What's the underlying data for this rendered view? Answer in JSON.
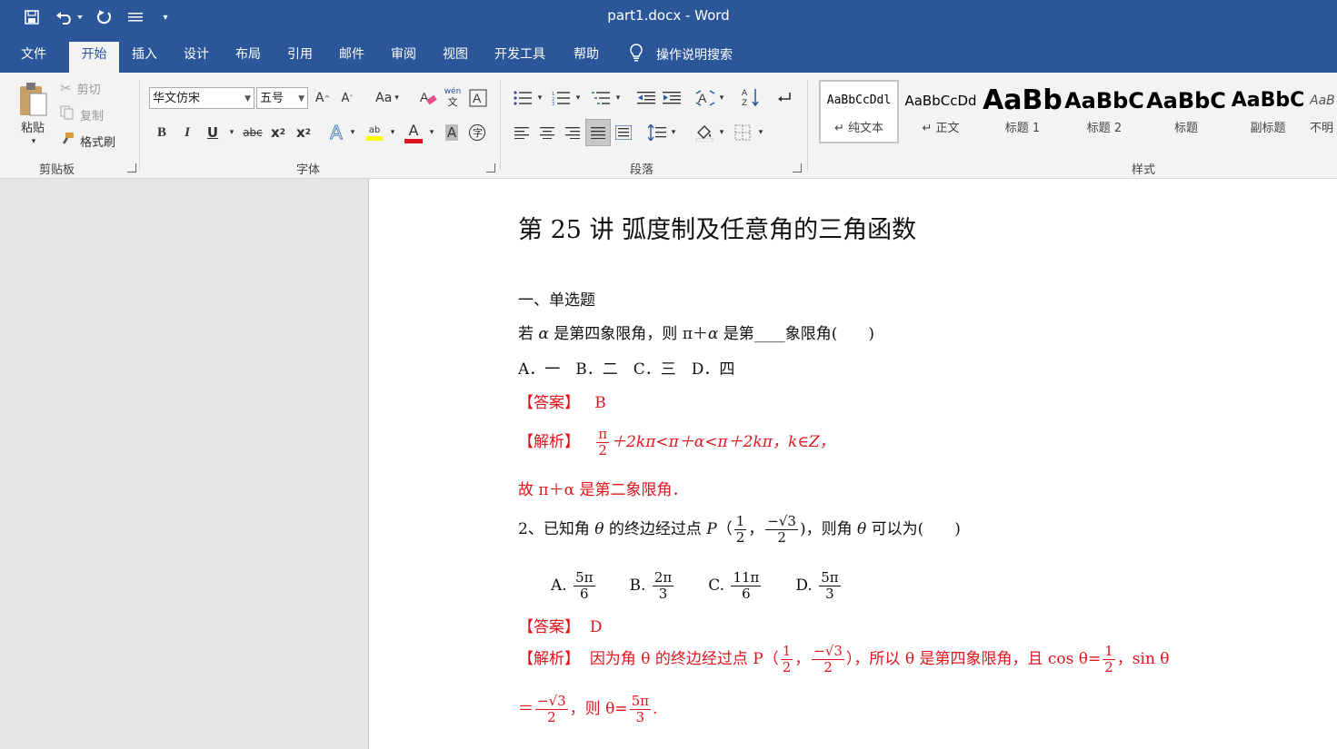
{
  "window": {
    "title": "part1.docx  -  Word"
  },
  "tabs": [
    "文件",
    "开始",
    "插入",
    "设计",
    "布局",
    "引用",
    "邮件",
    "审阅",
    "视图",
    "开发工具",
    "帮助"
  ],
  "tell_me": "操作说明搜索",
  "clipboard": {
    "paste": "粘贴",
    "cut": "剪切",
    "copy": "复制",
    "format_painter": "格式刷",
    "label": "剪贴板"
  },
  "font": {
    "name": "华文仿宋",
    "size": "五号",
    "change_case": "Aa",
    "label": "字体"
  },
  "paragraph": {
    "label": "段落"
  },
  "styles": {
    "label": "样式",
    "items": [
      {
        "sample": "AaBbCcDdl",
        "name": "纯文本"
      },
      {
        "sample": "AaBbCcDd",
        "name": "正文"
      },
      {
        "sample": "AaBb",
        "name": "标题 1"
      },
      {
        "sample": "AaBbC",
        "name": "标题 2"
      },
      {
        "sample": "AaBbC",
        "name": "标题"
      },
      {
        "sample": "AaBbC",
        "name": "副标题"
      },
      {
        "sample": "AaB",
        "name": "不明"
      }
    ]
  },
  "document": {
    "heading": "第 25 讲  弧度制及任意角的三角函数",
    "section1": "一、单选题",
    "q1": {
      "stem_a": "若",
      "alpha": "α",
      "stem_b": " 是第四象限角，则 π＋",
      "stem_c": " 是第____象限角(　　)",
      "options": "A．一　B．二　C．三　D．四",
      "answer_tag": "【答案】",
      "answer": "B",
      "analysis_tag": "【解析】",
      "frac_num": "π",
      "frac_den": "2",
      "analysis_rest": "＋2kπ<π＋α<π＋2kπ，k∈Z，",
      "conclusion": "故 π＋α 是第二象限角．"
    },
    "q2": {
      "stem_a": "2、已知角 ",
      "theta": "θ",
      "stem_b": " 的终边经过点 ",
      "point": "P",
      "stem_c": "，则角 ",
      "stem_d": " 可以为(　　)",
      "half_num": "1",
      "half_den": "2",
      "sqrt3": "−√3",
      "options": [
        {
          "letter": "A.",
          "num": "5π",
          "den": "6"
        },
        {
          "letter": "B.",
          "num": "2π",
          "den": "3"
        },
        {
          "letter": "C.",
          "num": "11π",
          "den": "6"
        },
        {
          "letter": "D.",
          "num": "5π",
          "den": "3"
        }
      ],
      "answer_tag": "【答案】",
      "answer": "D",
      "analysis_tag": "【解析】",
      "analysis_a": "因为角 θ 的终边经过点 P（",
      "analysis_b": "），所以 θ 是第四象限角，且 cos θ=",
      "analysis_c": "，sin θ",
      "analysis_d": "＝",
      "analysis_e": "，则 θ=",
      "result_num": "5π",
      "result_den": "3",
      "period": "."
    }
  }
}
